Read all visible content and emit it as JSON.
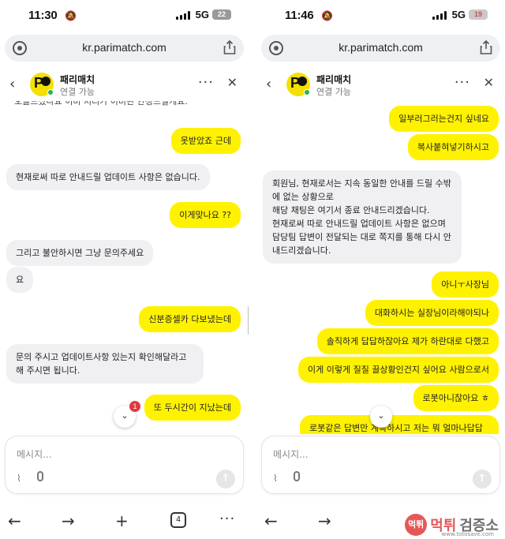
{
  "left": {
    "status": {
      "time": "11:30",
      "network": "5G",
      "battery": "22"
    },
    "browser": {
      "url": "kr.parimatch.com"
    },
    "chat": {
      "name": "패리매치",
      "status": "연결 가능"
    },
    "messages": {
      "cut_top": "오늘드셨나요 이미 처리가 이미된 안정드릴게요.",
      "m1": "못받았죠 근데",
      "m2": "현재로써 따로 안내드릴 업데이트 사항은 없습니다.",
      "m3": "이게맞나요 ??",
      "m4": "그리고 불안하시면 그냥 문의주세요",
      "m5": "요",
      "m6": "신분증셀카 다보냈는데",
      "m7": "문의 주시고 업데이트사항 있는지 확인해달라고 해 주시면 됩니다.",
      "m8": "또 두시간이 지났는데",
      "unread": "1"
    },
    "composer": {
      "placeholder": "메시지..."
    },
    "nav": {
      "tab_count": "4"
    }
  },
  "right": {
    "status": {
      "time": "11:46",
      "network": "5G",
      "battery": "19"
    },
    "browser": {
      "url": "kr.parimatch.com"
    },
    "chat": {
      "name": "패리매치",
      "status": "연결 가능"
    },
    "messages": {
      "r1": "일부러그러는건지 싶네요",
      "r2": "복사붙혀넣기하시고",
      "r3": "회원님, 현재로서는 지속 동일한 안내를 드릴 수밖에 없는 상황으로\n해당 채팅은 여기서 종료 안내드리겠습니다.\n현재로써 따로 안내드릴 업데이트 사항은 없으며 담당팀 답변이 전달되는 대로 쪽지를 통해 다시 안내드리겠습니다.",
      "r4": "아니ㅜ사장님",
      "r5": "대화하시는 실장님이라해야되나",
      "r6": "솔직하게 답답하잖아요 제가 하란대로 다했고",
      "r7": "이게 이렇게 질질 끌상황인건지 싶어요 사람으로서",
      "r8": "로봇아니잖아요 ㅎ",
      "r9": "로봇같은 답변만 계속하시고 저는 뭐 얼마나답답할까요"
    },
    "composer": {
      "placeholder": "메시지..."
    }
  },
  "watermark": {
    "logo": "먹튀",
    "text_a": "먹튀",
    "text_b": "검증소",
    "small": "www.totosave.com"
  },
  "colors": {
    "outgoing_bubble": "#fff200",
    "incoming_bubble": "#f0f0f2",
    "unread_badge": "#e0393e",
    "online_dot": "#2bb24c"
  }
}
